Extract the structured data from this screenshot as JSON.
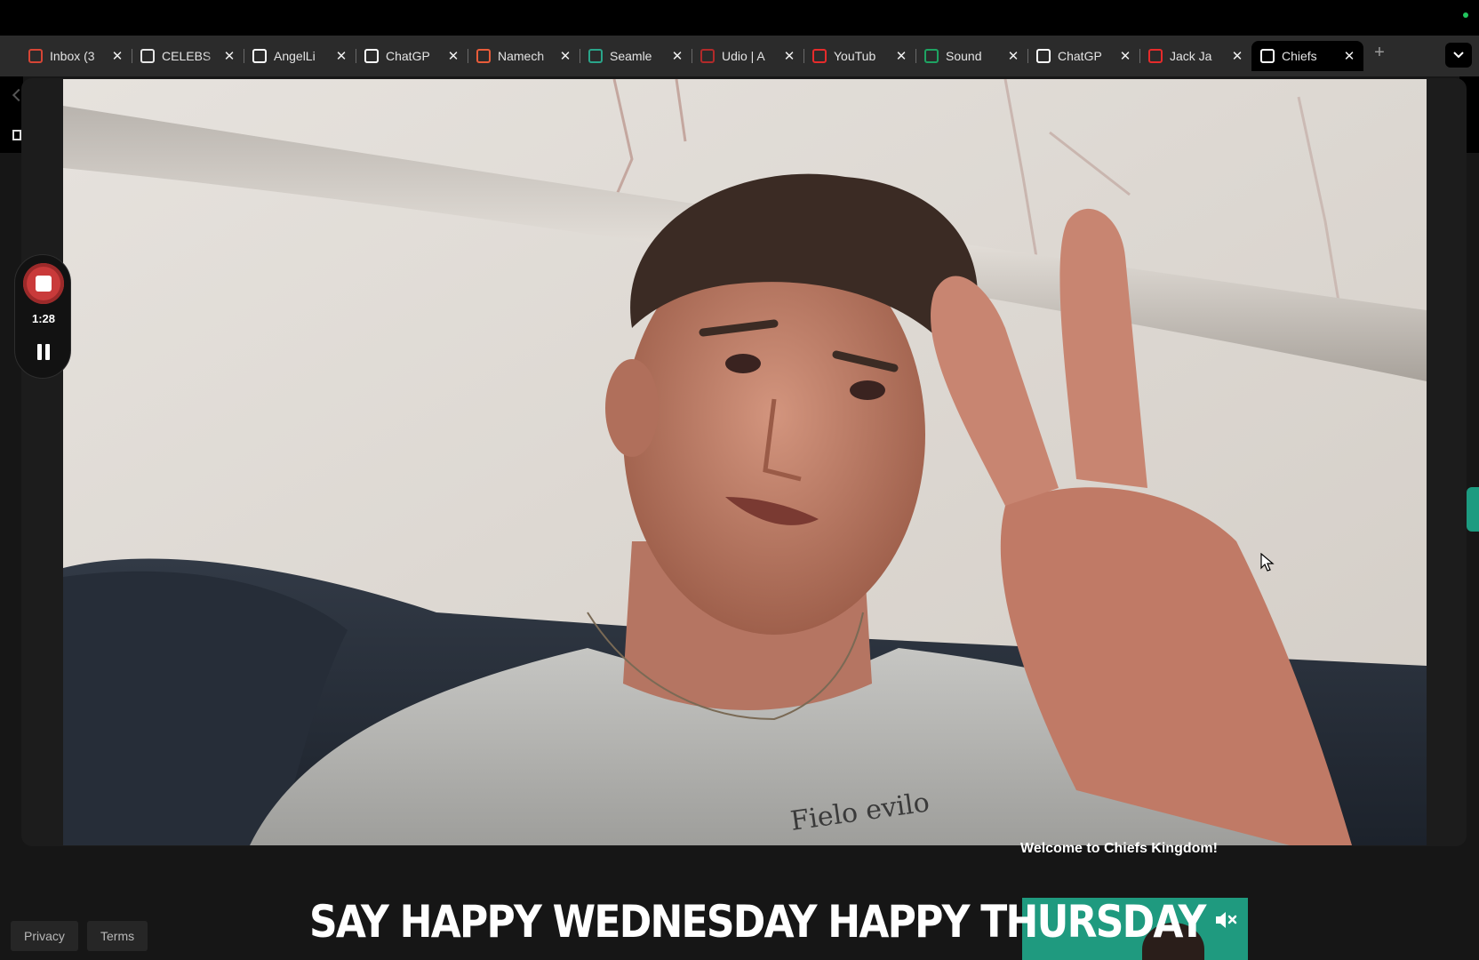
{
  "browser": {
    "tabs": [
      {
        "title": "Inbox (3",
        "favicon": "gmail-icon",
        "color": "#d64535"
      },
      {
        "title": "CELEBS",
        "favicon": "celebs-icon",
        "color": "#e6e6e6"
      },
      {
        "title": "AngelLi",
        "favicon": "angellist-icon",
        "color": "#ffffff"
      },
      {
        "title": "ChatGP",
        "favicon": "chatgpt-icon",
        "color": "#ffffff"
      },
      {
        "title": "Namech",
        "favicon": "namecheap-icon",
        "color": "#e85c3a"
      },
      {
        "title": "Seamle",
        "favicon": "seamless-icon",
        "color": "#2aa58a"
      },
      {
        "title": "Udio | A",
        "favicon": "udio-icon",
        "color": "#b22a2a"
      },
      {
        "title": "YouTub",
        "favicon": "youtube-icon",
        "color": "#e62b2b"
      },
      {
        "title": "Sound",
        "favicon": "sheets-icon",
        "color": "#1ea362"
      },
      {
        "title": "ChatGP",
        "favicon": "chatgpt-icon",
        "color": "#ffffff"
      },
      {
        "title": "Jack Ja",
        "favicon": "youtube-icon",
        "color": "#e62b2b"
      },
      {
        "title": "Chiefs",
        "favicon": "document-icon",
        "color": "#ffffff",
        "active": true
      }
    ]
  },
  "recorder": {
    "time": "1:28"
  },
  "page": {
    "welcome": "Welcome to Chiefs Kingdom!",
    "caption": "SAY HAPPY WEDNESDAY HAPPY THURSDAY",
    "footer": {
      "privacy": "Privacy",
      "terms": "Terms"
    }
  },
  "colors": {
    "record": "#c93a3a",
    "accent": "#1f9a7f"
  }
}
